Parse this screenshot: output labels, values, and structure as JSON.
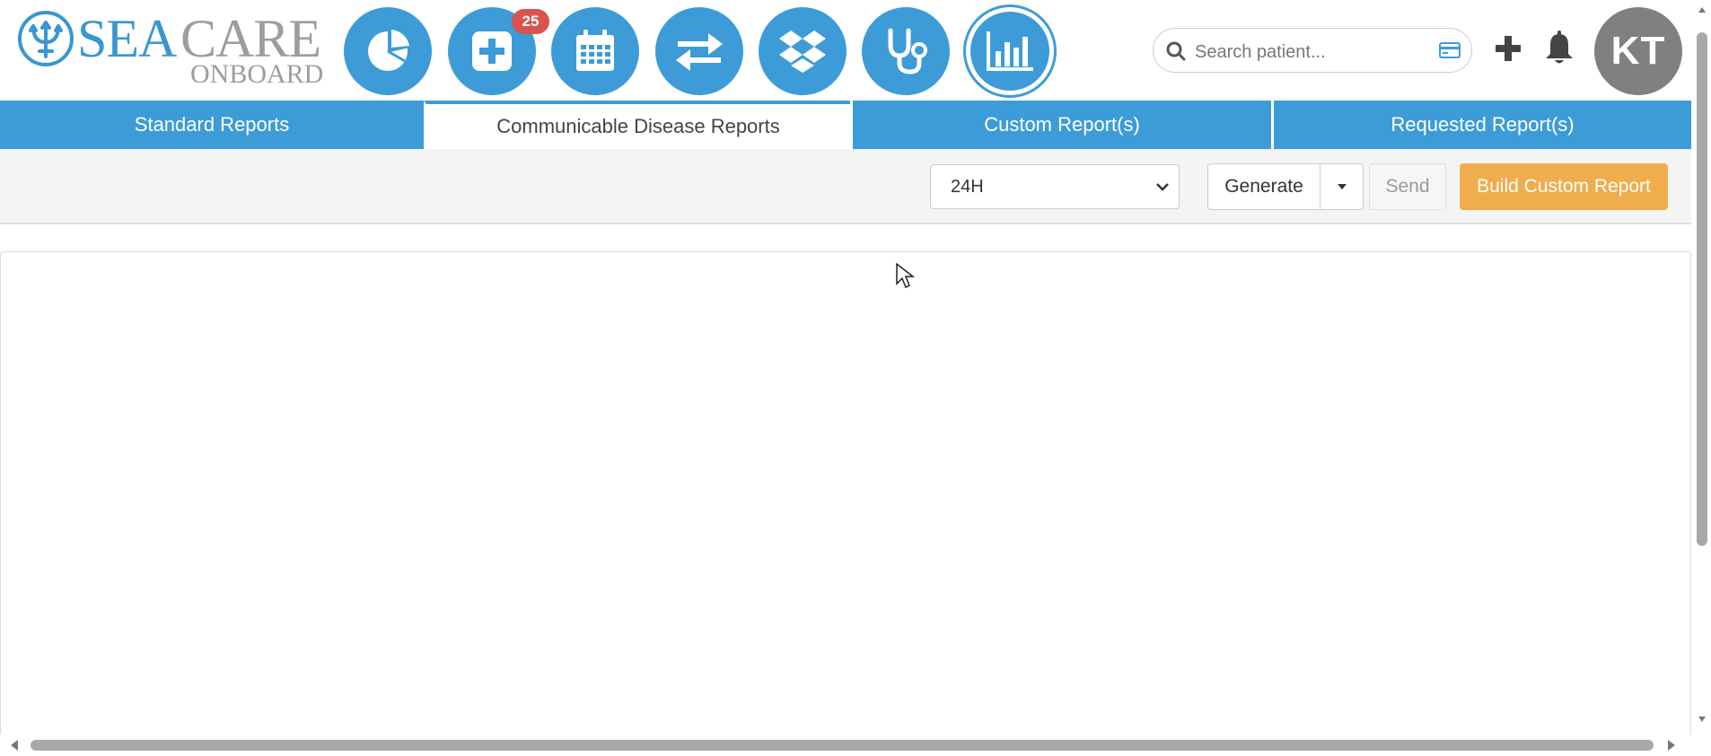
{
  "brand": {
    "sea": "SEA",
    "care": "CARE",
    "onboard": "ONBOARD",
    "primary_color": "#3d9cd7"
  },
  "nav": {
    "items": [
      {
        "name": "dashboard",
        "icon": "pie-chart-icon"
      },
      {
        "name": "medical",
        "icon": "medical-cross-icon",
        "badge": "25"
      },
      {
        "name": "calendar",
        "icon": "calendar-icon"
      },
      {
        "name": "transfer",
        "icon": "transfer-arrows-icon"
      },
      {
        "name": "inventory",
        "icon": "dropbox-icon"
      },
      {
        "name": "consultation",
        "icon": "stethoscope-icon"
      },
      {
        "name": "reports",
        "icon": "bar-chart-icon",
        "active": true
      }
    ]
  },
  "search": {
    "placeholder": "Search patient..."
  },
  "user": {
    "initials": "KT"
  },
  "tabs": [
    {
      "label": "Standard Reports",
      "active": false
    },
    {
      "label": "Communicable Disease Reports",
      "active": true
    },
    {
      "label": "Custom Report(s)",
      "active": false
    },
    {
      "label": "Requested Report(s)",
      "active": false
    }
  ],
  "toolbar": {
    "period_value": "24H",
    "generate_label": "Generate",
    "send_label": "Send",
    "build_label": "Build Custom Report",
    "build_color": "#f0ad4e"
  }
}
